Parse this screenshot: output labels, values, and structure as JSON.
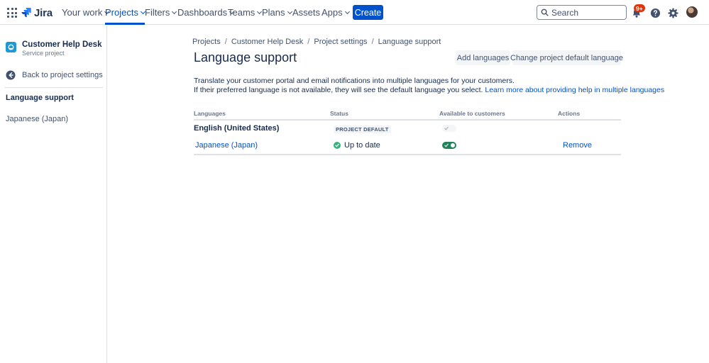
{
  "nav": {
    "logo": "Jira",
    "items": [
      {
        "label": "Your work",
        "dropdown": true
      },
      {
        "label": "Projects",
        "dropdown": true,
        "active": true
      },
      {
        "label": "Filters",
        "dropdown": true
      },
      {
        "label": "Dashboards",
        "dropdown": true
      },
      {
        "label": "Teams",
        "dropdown": true
      },
      {
        "label": "Plans",
        "dropdown": true
      },
      {
        "label": "Assets",
        "dropdown": false
      },
      {
        "label": "Apps",
        "dropdown": true
      }
    ],
    "create_label": "Create",
    "search_placeholder": "Search",
    "notifications_badge": "9+",
    "icons": [
      "app-switcher-icon",
      "jira-logo-icon",
      "search-icon",
      "bell-icon",
      "help-icon",
      "gear-icon"
    ]
  },
  "sidebar": {
    "project_name": "Customer Help Desk",
    "project_type": "Service project",
    "back_label": "Back to project settings",
    "section_title": "Language support",
    "items": [
      "Japanese (Japan)"
    ]
  },
  "breadcrumb": [
    "Projects",
    "Customer Help Desk",
    "Project settings",
    "Language support"
  ],
  "page": {
    "title": "Language support",
    "add_languages_label": "Add languages",
    "change_default_label": "Change project default language",
    "description_line1": "Translate your customer portal and email notifications into multiple languages for your customers.",
    "description_line2": "If their preferred language is not available, they will see the default language you select.",
    "learn_more_link": "Learn more about providing help in multiple languages"
  },
  "table": {
    "headers": {
      "languages": "Languages",
      "status": "Status",
      "available": "Available to customers",
      "actions": "Actions"
    },
    "rows": [
      {
        "language": "English (United States)",
        "status": "PROJECT DEFAULT",
        "available": true,
        "toggle_disabled": true,
        "action": ""
      },
      {
        "language": "Japanese (Japan)",
        "status": "Up to date",
        "available": true,
        "toggle_disabled": false,
        "action": "Remove"
      }
    ]
  },
  "colors": {
    "brand": "#0052cc",
    "success": "#36b37e",
    "badge": "#de350b",
    "text": "#172b4d"
  }
}
